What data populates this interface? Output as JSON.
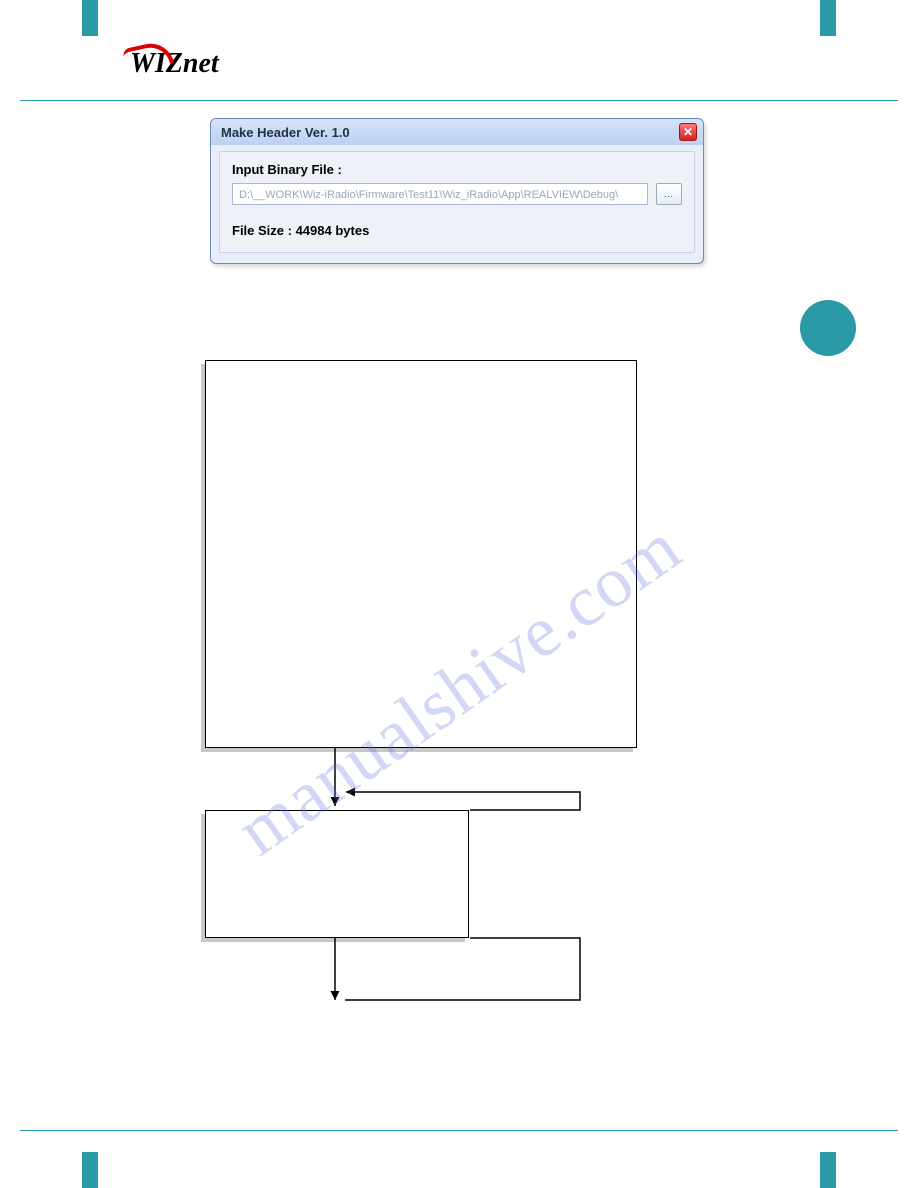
{
  "logo_text": "WIZnet",
  "dialog": {
    "title": "Make Header Ver. 1.0",
    "close_glyph": "✕",
    "input_label": "Input Binary File :",
    "input_value": "D:\\__WORK\\Wiz-iRadio\\Firmware\\Test11\\Wiz_iRadio\\App\\REALVIEW\\Debug\\",
    "browse_glyph": "…",
    "file_size_label": "File Size : 44984 bytes"
  },
  "watermark": "manualshive.com"
}
